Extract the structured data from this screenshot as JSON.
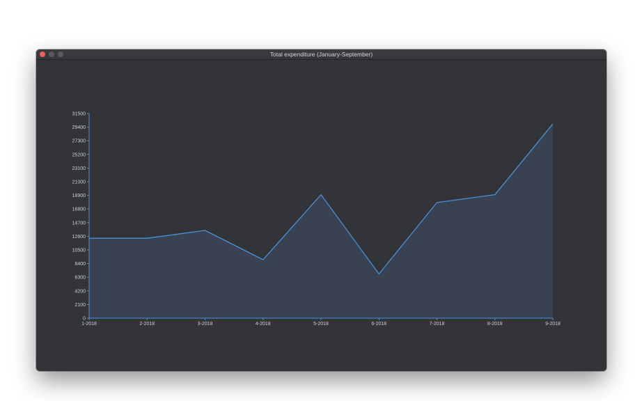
{
  "window": {
    "title": "Total expenditure (January-September)"
  },
  "colors": {
    "background": "#333438",
    "line": "#4a90d9",
    "area": "#3a4455",
    "axis": "#4a90d9",
    "tick_text": "#d0d0d0",
    "close_button": "#ec5f58"
  },
  "chart_data": {
    "type": "area",
    "title": "Total expenditure (January-September)",
    "xlabel": "",
    "ylabel": "",
    "categories": [
      "1-2018",
      "2-2018",
      "3-2018",
      "4-2018",
      "5-2018",
      "6-2018",
      "7-2018",
      "8-2018",
      "9-2018"
    ],
    "values": [
      12300,
      12300,
      13500,
      9000,
      19000,
      6800,
      17800,
      19000,
      29900
    ],
    "ylim": [
      0,
      31500
    ],
    "yticks": [
      "0",
      "2100",
      "4200",
      "6300",
      "8400",
      "10500",
      "12600",
      "14700",
      "16800",
      "18900",
      "21000",
      "23100",
      "25200",
      "27300",
      "29400",
      "31500"
    ],
    "grid": false,
    "legend": "none"
  }
}
